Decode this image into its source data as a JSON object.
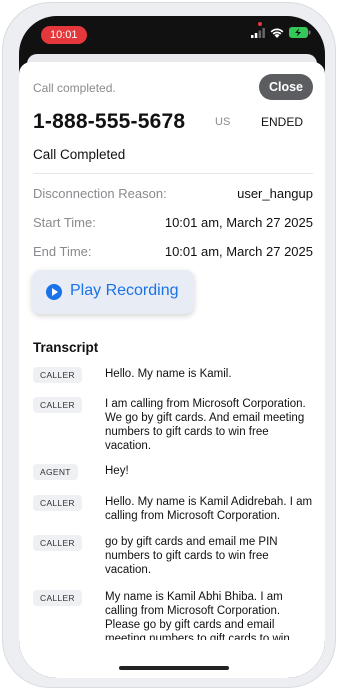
{
  "status_bar": {
    "time": "10:01"
  },
  "header": {
    "status_label": "Call completed.",
    "close_label": "Close"
  },
  "call": {
    "phone_number": "1-888-555-5678",
    "country": "US",
    "state": "ENDED",
    "status": "Call Completed",
    "details": [
      {
        "label": "Disconnection Reason:",
        "value": "user_hangup"
      },
      {
        "label": "Start Time:",
        "value": "10:01 am, March 27 2025"
      },
      {
        "label": "End Time:",
        "value": "10:01 am, March 27 2025"
      }
    ]
  },
  "player": {
    "label": "Play Recording"
  },
  "transcript": {
    "title": "Transcript",
    "messages": [
      {
        "role": "CALLER",
        "text": "Hello. My name is Kamil."
      },
      {
        "role": "CALLER",
        "text": "I am calling from Microsoft Corporation. We go by gift cards. And email meeting numbers to gift cards to win free vacation."
      },
      {
        "role": "AGENT",
        "text": "Hey!"
      },
      {
        "role": "CALLER",
        "text": "Hello. My name is Kamil Adidrebah. I am calling from Microsoft Corporation."
      },
      {
        "role": "CALLER",
        "text": "go by gift cards and email me PIN numbers to gift cards to win free vacation."
      },
      {
        "role": "CALLER",
        "text": "My name is Kamil Abhi Bhiba. I am calling from Microsoft Corporation. Please go by gift cards and email meeting numbers to gift cards to win"
      }
    ]
  }
}
